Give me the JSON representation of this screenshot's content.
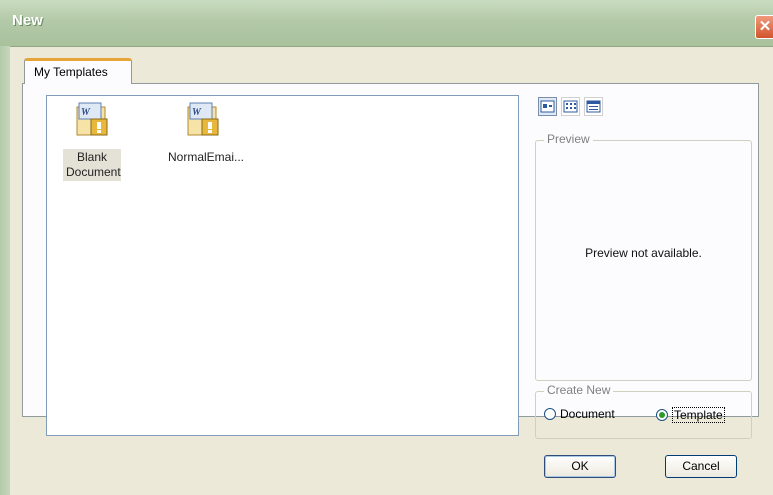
{
  "window": {
    "title": "New",
    "close_glyph": "✕"
  },
  "tabs": [
    {
      "label": "My Templates"
    }
  ],
  "templates": [
    {
      "label": "Blank Document",
      "icon": "word-template-icon",
      "selected": true
    },
    {
      "label": "NormalEmai...",
      "icon": "word-template-icon",
      "selected": false
    }
  ],
  "view_modes": [
    {
      "icon": "large-icons-view-icon",
      "active": true
    },
    {
      "icon": "list-view-icon",
      "active": false
    },
    {
      "icon": "details-view-icon",
      "active": false
    }
  ],
  "preview": {
    "title": "Preview",
    "message": "Preview not available."
  },
  "create_new": {
    "title": "Create New",
    "options": [
      {
        "label": "Document",
        "checked": false
      },
      {
        "label": "Template",
        "checked": true
      }
    ]
  },
  "buttons": {
    "ok": "OK",
    "cancel": "Cancel"
  },
  "colors": {
    "titlebar": "#b3c9a8",
    "tab_accent": "#e6a53a",
    "close": "#d2542c",
    "radio_checked": "#2a9a2a"
  }
}
